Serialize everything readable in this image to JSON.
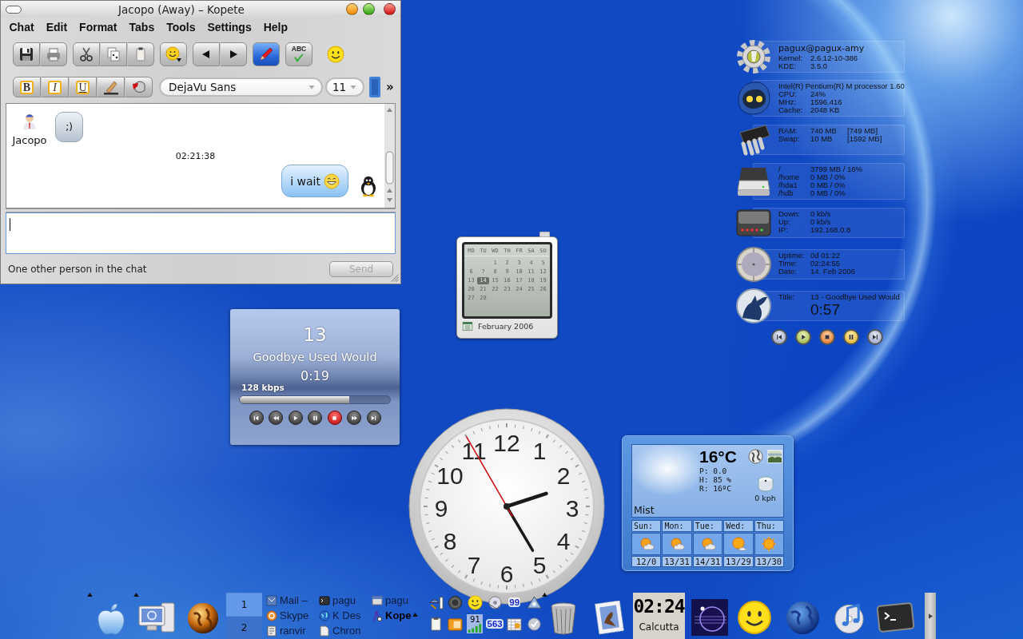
{
  "kopete": {
    "title": "Jacopo (Away) – Kopete",
    "menu": [
      "Chat",
      "Edit",
      "Format",
      "Tabs",
      "Tools",
      "Settings",
      "Help"
    ],
    "toolbar": [
      [
        {
          "on": false
        },
        {
          "on": false
        }
      ],
      [
        {
          "on": false
        },
        {
          "on": false
        },
        {
          "on": false
        }
      ],
      [
        {
          "on": false
        }
      ],
      [
        {
          "on": false
        },
        {
          "on": false
        }
      ],
      [
        {
          "on": true
        }
      ]
    ],
    "spellcheck": {
      "label": "ABC"
    },
    "format_buttons": [
      "B",
      "I",
      "U"
    ],
    "font": "DejaVu Sans",
    "font_size": "11",
    "overflow": "»",
    "messages": [
      {
        "kind": "incoming",
        "sender": "Jacopo",
        "text": ";)"
      },
      {
        "kind": "timestamp",
        "text": "02:21:38"
      },
      {
        "kind": "outgoing",
        "text": "i wait",
        "emoticon": true
      }
    ],
    "status": "One other person in the chat",
    "send": {
      "label": "Send",
      "disabled": true
    }
  },
  "sysinfo": {
    "sections": [
      {
        "kind": "system",
        "header": "pagux@pagux-amy",
        "rows": [
          [
            "Kernel:",
            "2.6.12-10-386"
          ],
          [
            "KDE:",
            "3.5.0"
          ]
        ]
      },
      {
        "kind": "cpu",
        "header": "Intel(R) Pentium(R) M processor 1.60",
        "rows": [
          [
            "CPU:",
            "24%"
          ],
          [
            "MHz:",
            "1596.416"
          ],
          [
            "Cache:",
            "2048 KB"
          ]
        ]
      },
      {
        "kind": "memory",
        "rows": [
          [
            "RAM:",
            "740 MB",
            "[749 MB]"
          ],
          [
            "Swap:",
            "10 MB",
            "[1592 MB]"
          ]
        ]
      },
      {
        "kind": "disk",
        "rows": [
          [
            "/",
            "3799 MB / 16%"
          ],
          [
            "/home",
            "0 MB / 0%"
          ],
          [
            "/hda1",
            "0 MB / 0%"
          ],
          [
            "/hdb",
            "0 MB / 0%"
          ]
        ]
      },
      {
        "kind": "network",
        "rows": [
          [
            "Down:",
            "0 kb/s"
          ],
          [
            "Up:",
            "0 kb/s"
          ],
          [
            "IP:",
            "192.168.0.8"
          ]
        ]
      },
      {
        "kind": "uptime",
        "rows": [
          [
            "Uptime:",
            "0d 01:22"
          ],
          [
            "Time:",
            "02:24:55"
          ],
          [
            "Date:",
            "14. Feb 2006"
          ]
        ]
      },
      {
        "kind": "music",
        "rows": [
          [
            "Title:",
            "13 - Goodbye Used Would"
          ]
        ],
        "big": "0:57"
      }
    ]
  },
  "calendar": {
    "weekdays": [
      "MO",
      "TU",
      "WD",
      "TH",
      "FR",
      "SA",
      "SU"
    ],
    "weeks": [
      [
        {
          "day": "1",
          "selected": false
        },
        {
          "day": "2",
          "selected": false
        },
        {
          "day": "3",
          "selected": false
        },
        {
          "day": "4",
          "selected": false
        },
        {
          "day": "5",
          "selected": false
        }
      ],
      [
        {
          "day": "6",
          "selected": false
        },
        {
          "day": "7",
          "selected": false
        },
        {
          "day": "8",
          "selected": false
        },
        {
          "day": "9",
          "selected": false
        },
        {
          "day": "10",
          "selected": false
        },
        {
          "day": "11",
          "selected": false
        },
        {
          "day": "12",
          "selected": false
        }
      ],
      [
        {
          "day": "13",
          "selected": false
        },
        {
          "day": "14",
          "selected": true
        },
        {
          "day": "15",
          "selected": false
        },
        {
          "day": "16",
          "selected": false
        },
        {
          "day": "17",
          "selected": false
        },
        {
          "day": "18",
          "selected": false
        },
        {
          "day": "19",
          "selected": false
        }
      ],
      [
        {
          "day": "20",
          "selected": false
        },
        {
          "day": "21",
          "selected": false
        },
        {
          "day": "22",
          "selected": false
        },
        {
          "day": "23",
          "selected": false
        },
        {
          "day": "24",
          "selected": false
        },
        {
          "day": "25",
          "selected": false
        },
        {
          "day": "26",
          "selected": false
        }
      ],
      [
        {
          "day": "27",
          "selected": false
        },
        {
          "day": "28",
          "selected": false
        }
      ]
    ],
    "month": "February 2006"
  },
  "player": {
    "track": "13",
    "title": "Goodbye Used Would",
    "time": "0:19",
    "bitrate": "128 kbps",
    "level": 0.73
  },
  "clock": {
    "numbers": [
      "12",
      "11",
      "1",
      "10",
      "2",
      "9",
      "3",
      "8",
      "4",
      "7",
      "5",
      "6"
    ]
  },
  "weather": {
    "temperature": "16°C",
    "details": [
      "P: 0.0",
      "H: 85 %",
      "R: 16ºC"
    ],
    "wind": "0 kph",
    "condition": "Mist",
    "forecast": [
      {
        "day": "Sun:",
        "kind": "partly-cloudy",
        "temps": "12/0"
      },
      {
        "day": "Mon:",
        "kind": "partly-cloudy",
        "temps": "13/31"
      },
      {
        "day": "Tue:",
        "kind": "partly-cloudy",
        "temps": "14/31"
      },
      {
        "day": "Wed:",
        "kind": "mostly-sunny",
        "temps": "13/29"
      },
      {
        "day": "Thu:",
        "kind": "sunny",
        "temps": "13/30"
      }
    ]
  },
  "taskbar": {
    "pager": [
      {
        "label": "1",
        "selected": true
      },
      {
        "label": "2",
        "selected": false
      }
    ],
    "tasks": [
      {
        "kind": "mail",
        "label": "Mail –",
        "active": false
      },
      {
        "kind": "chat",
        "label": "Skype",
        "active": false
      },
      {
        "kind": "notes",
        "label": "ranvir",
        "active": false
      },
      {
        "kind": "terminal",
        "label": "pagu",
        "active": false
      },
      {
        "kind": "globe",
        "label": "K Des",
        "active": false
      },
      {
        "kind": "document",
        "label": "Chron",
        "active": false
      },
      {
        "kind": "window",
        "label": "pagu",
        "active": false
      },
      {
        "kind": "contact",
        "label": "Kope",
        "active": true
      }
    ],
    "tray": [
      {
        "kind": "network"
      },
      {
        "kind": "speaker"
      },
      {
        "kind": "smiley"
      },
      {
        "kind": "disc"
      },
      {
        "kind": "counter",
        "text": "99"
      },
      {
        "kind": "triangle"
      },
      {
        "kind": "clipboard"
      },
      {
        "kind": "folder"
      },
      {
        "kind": "signal",
        "text": "91"
      },
      {
        "kind": "counter",
        "text": "563"
      },
      {
        "kind": "calendar"
      },
      {
        "kind": "check"
      }
    ],
    "clock": {
      "time": "02:24",
      "city": "Calcutta"
    }
  }
}
